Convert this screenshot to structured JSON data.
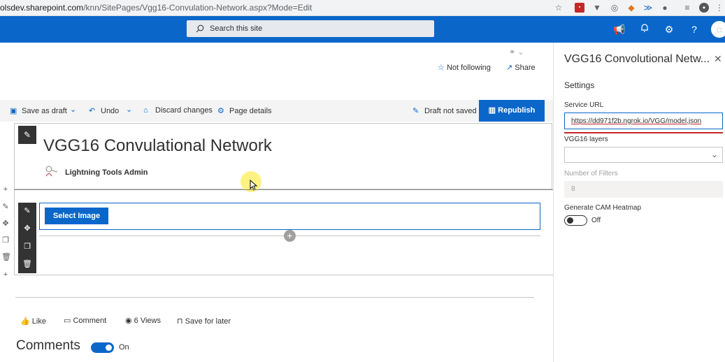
{
  "browser": {
    "url_host": "olsdev.sharepoint.com",
    "url_path": "/knn/SitePages/Vgg16-Convulation-Network.aspx?Mode=Edit"
  },
  "suite": {
    "search_placeholder": "Search this site"
  },
  "header": {
    "not_following": "Not following",
    "share": "Share"
  },
  "toolbar": {
    "save_as_draft": "Save as draft",
    "undo": "Undo",
    "discard": "Discard changes",
    "page_details": "Page details",
    "draft_status": "Draft not saved",
    "republish": "Republish"
  },
  "page": {
    "title": "VGG16 Convulational Network",
    "author": "Lightning Tools Admin",
    "select_image": "Select Image"
  },
  "social": {
    "like": "Like",
    "comment": "Comment",
    "views": "6 Views",
    "save_for_later": "Save for later",
    "comments_heading": "Comments",
    "comments_toggle": "On"
  },
  "panel": {
    "title": "VGG16 Convolutional Netw...",
    "settings": "Settings",
    "service_url_label": "Service URL",
    "service_url_value": "https://dd971f2b.ngrok.io/VGG/model.json",
    "layers_label": "VGG16 layers",
    "filters_label": "Number of Filters",
    "filters_value": "8",
    "heatmap_label": "Generate CAM Heatmap",
    "heatmap_state": "Off"
  },
  "colors": {
    "brand": "#0a67c9",
    "toolbar_bg": "#f4f4f4",
    "dark_edit": "#333333",
    "error_underline": "#c4262e"
  }
}
